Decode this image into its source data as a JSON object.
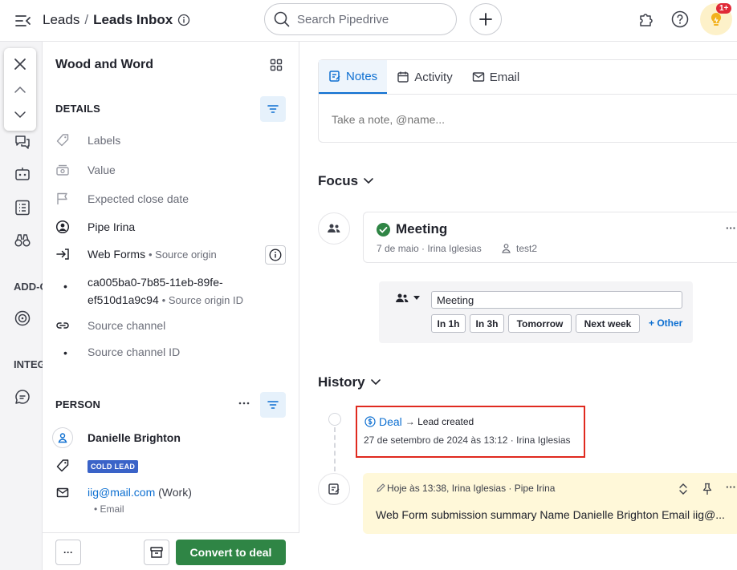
{
  "header": {
    "breadcrumb_root": "Leads",
    "breadcrumb_sep": "/",
    "breadcrumb_current": "Leads Inbox",
    "search_placeholder": "Search Pipedrive",
    "notification_badge": "1+"
  },
  "leftnav": {
    "label_add": "ADD-ONS",
    "label_integ": "INTEGRATIONS"
  },
  "panel": {
    "title": "Wood and Word",
    "details_heading": "DETAILS",
    "details": {
      "labels": "Labels",
      "value": "Value",
      "close_date": "Expected close date",
      "owner": "Pipe Irina",
      "source_origin_value": "Web Forms",
      "source_origin_label": "• Source origin",
      "origin_id_line1": "ca005ba0-7b85-11eb-89fe-",
      "origin_id_line2": "ef510d1a9c94",
      "origin_id_label": "• Source origin ID",
      "source_channel": "Source channel",
      "source_channel_id": "Source channel ID"
    },
    "person_heading": "PERSON",
    "person": {
      "name": "Danielle Brighton",
      "tag": "COLD LEAD",
      "email": "iig@mail.com",
      "email_type": "(Work)",
      "email_label": "• Email"
    },
    "footer": {
      "more_label": "···",
      "convert_label": "Convert to deal"
    }
  },
  "main": {
    "tabs": [
      {
        "label": "Notes",
        "icon": "note-icon"
      },
      {
        "label": "Activity",
        "icon": "calendar-icon"
      },
      {
        "label": "Email",
        "icon": "mail-icon"
      }
    ],
    "note_placeholder": "Take a note, @name...",
    "focus_title": "Focus",
    "activity": {
      "title": "Meeting",
      "meta": "7 de maio · Irina Iglesias",
      "participant": "test2",
      "more": "···"
    },
    "scheduler": {
      "input_value": "Meeting",
      "chips": [
        "In 1h",
        "In 3h",
        "Tomorrow",
        "Next week"
      ],
      "other": "+ Other"
    },
    "history_title": "History",
    "history_item": {
      "link": "Deal",
      "text": "→ Lead created",
      "meta": "27 de setembro de 2024 às 13:12 · Irina Iglesias"
    },
    "note": {
      "meta": "Hoje às 13:38, Irina Iglesias · Pipe Irina",
      "body": "Web Form submission summary Name Danielle Brighton Email iig@...",
      "more": "···"
    }
  },
  "colors": {
    "accent": "#0d6fd1",
    "convert_green": "#2f8545",
    "highlight_red": "#e02a1f",
    "note_bg": "#fff8d9"
  }
}
